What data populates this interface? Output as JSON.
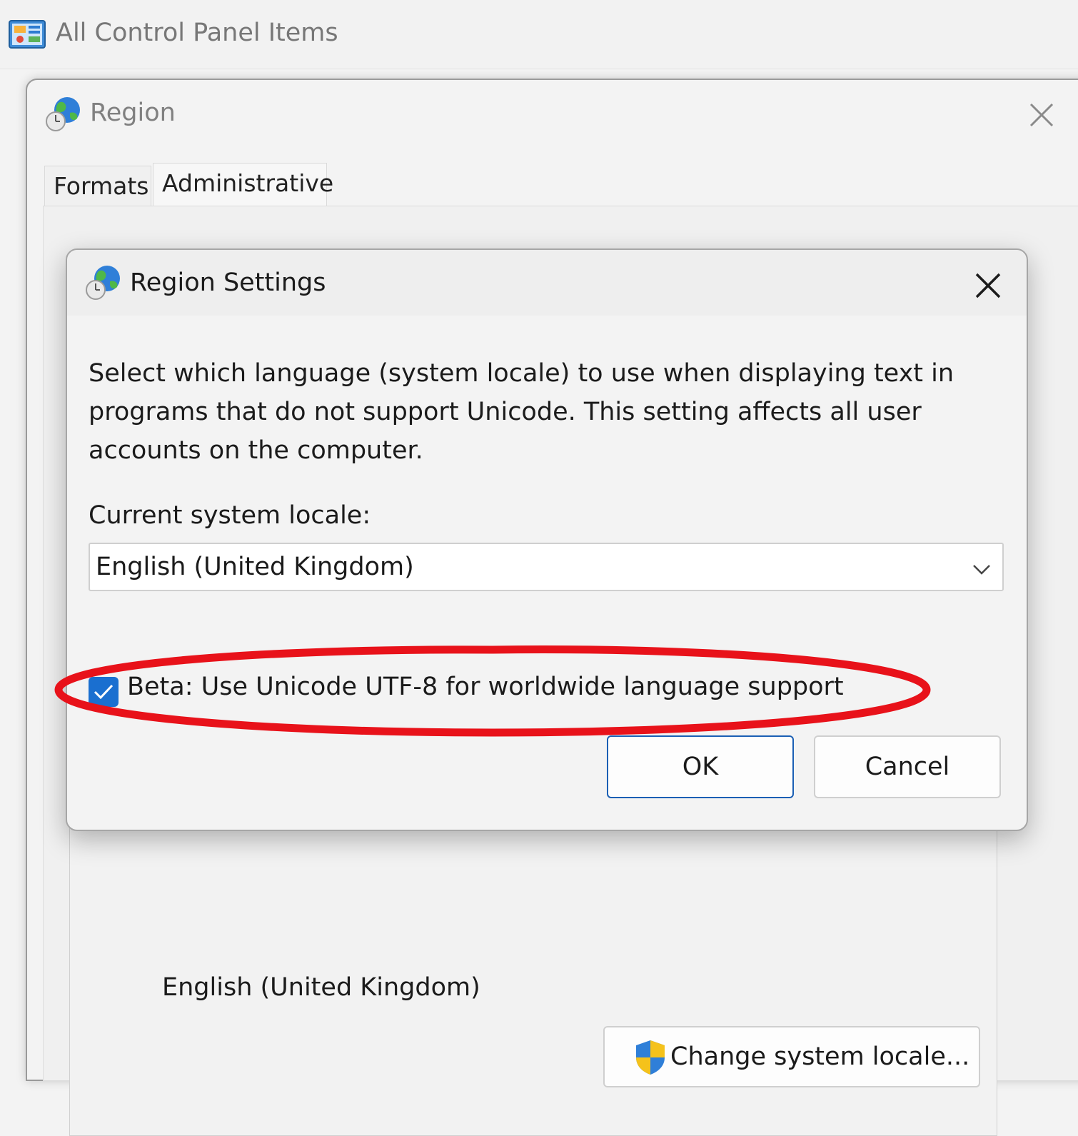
{
  "control_panel": {
    "title": "All Control Panel Items"
  },
  "region_window": {
    "title": "Region",
    "tabs": [
      {
        "label": "Formats",
        "active": false
      },
      {
        "label": "Administrative",
        "active": true
      }
    ],
    "current_locale_value": "English (United Kingdom)",
    "change_locale_button": "Change system locale..."
  },
  "region_settings_dialog": {
    "title": "Region Settings",
    "description": "Select which language (system locale) to use when displaying text in programs that do not support Unicode. This setting affects all user accounts on the computer.",
    "locale_label": "Current system locale:",
    "locale_selected": "English (United Kingdom)",
    "utf8_checkbox_label": "Beta: Use Unicode UTF-8 for worldwide language support",
    "utf8_checked": true,
    "ok_label": "OK",
    "cancel_label": "Cancel"
  },
  "colors": {
    "highlight": "#e8121a",
    "accent": "#1a6fd0",
    "window_bg": "#f3f3f3"
  },
  "icons": [
    "control-panel-icon",
    "globe-clock-icon",
    "close-icon",
    "chevron-down-icon",
    "checkmark-icon",
    "uac-shield-icon"
  ]
}
